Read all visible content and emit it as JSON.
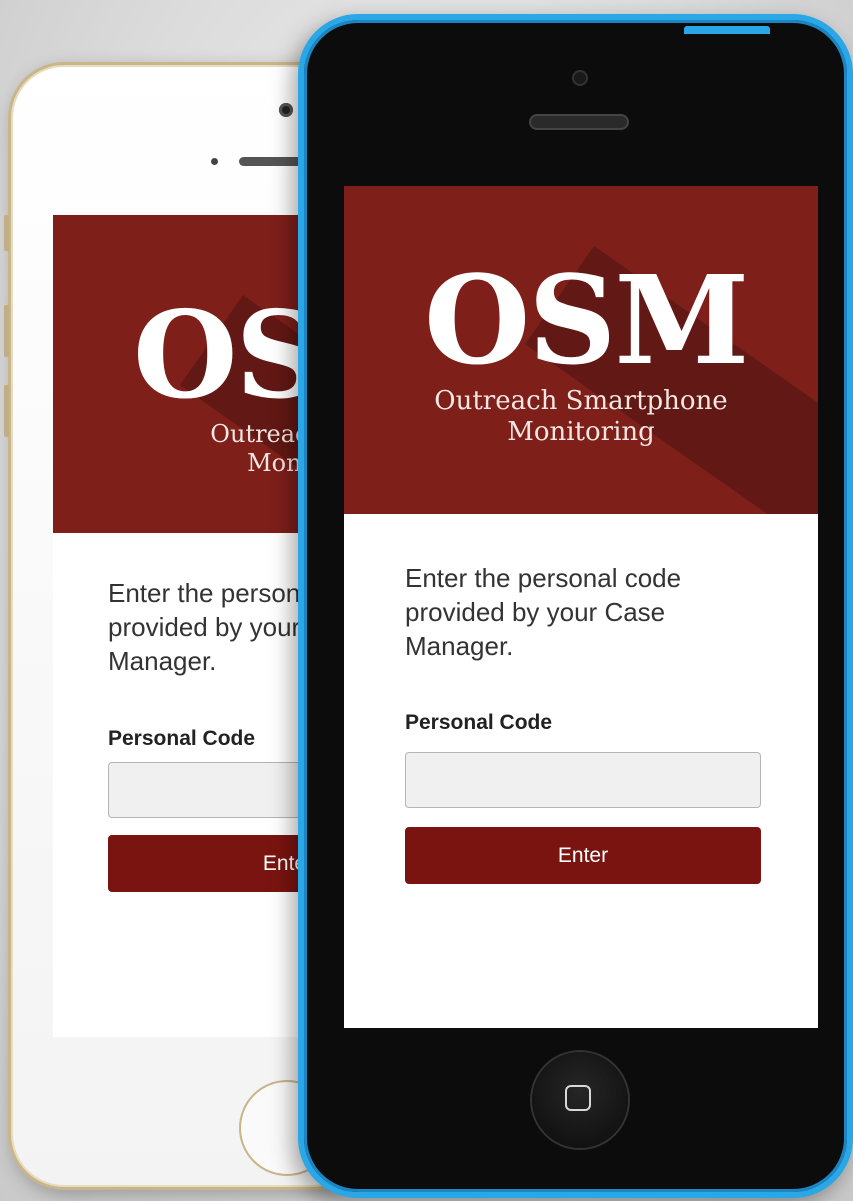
{
  "app": {
    "logo": "OSM",
    "subtitle_line1": "Outreach Smartphone",
    "subtitle_line2": "Monitoring",
    "instructions": "Enter the personal code provided by your Case Manager.",
    "code_label": "Personal Code",
    "code_value": "",
    "enter_label": "Enter"
  },
  "back_phone": {
    "subtitle_line1": "Outreach Sı",
    "subtitle_line2": "Monit"
  },
  "colors": {
    "header_red": "#7e1f1a",
    "button_red": "#7a1410",
    "front_phone_frame": "#29a7e6",
    "back_phone_frame": "#c9b58a"
  }
}
